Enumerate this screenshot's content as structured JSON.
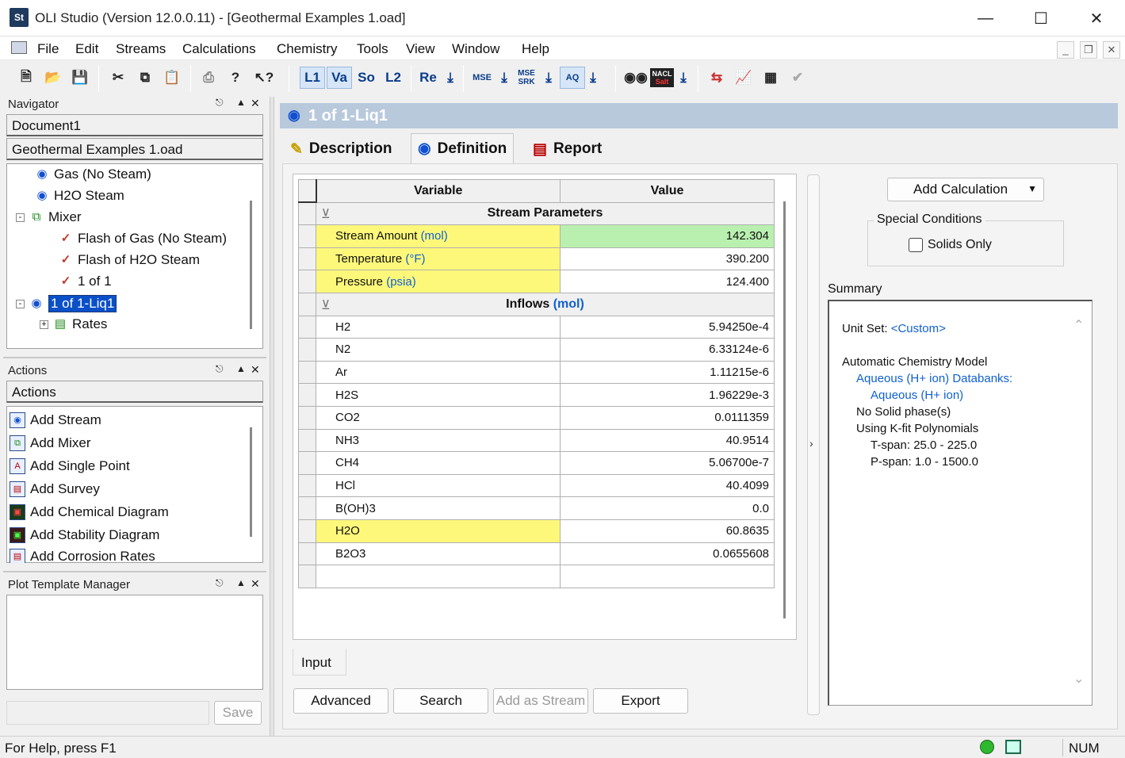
{
  "window": {
    "title": "OLI Studio (Version 12.0.0.11) - [Geothermal Examples 1.oad]",
    "app_icon": "St"
  },
  "menu": [
    "File",
    "Edit",
    "Streams",
    "Calculations",
    "Chemistry",
    "Tools",
    "View",
    "Window",
    "Help"
  ],
  "toolbar": {
    "l1": "L1",
    "va": "Va",
    "so": "So",
    "l2": "L2",
    "re": "Re",
    "mse": "MSE",
    "mse_srk": "MSE SRK",
    "aq": "AQ",
    "nacl": "NACL",
    "salt": "Salt"
  },
  "navigator": {
    "title": "Navigator",
    "document": "Document1",
    "file": "Geothermal Examples 1.oad",
    "tree": [
      "Gas (No Steam)",
      "H2O Steam",
      "Mixer",
      "Flash of Gas (No Steam)",
      "Flash of H2O Steam",
      "1 of 1",
      "1 of 1-Liq1",
      "Rates"
    ]
  },
  "actions": {
    "title": "Actions",
    "header": "Actions",
    "items": [
      "Add Stream",
      "Add Mixer",
      "Add Single Point",
      "Add Survey",
      "Add Chemical Diagram",
      "Add Stability Diagram",
      "Add Corrosion Rates"
    ]
  },
  "plot_template": {
    "title": "Plot Template Manager",
    "save": "Save"
  },
  "document": {
    "header": "1 of 1-Liq1",
    "tabs": [
      "Description",
      "Definition",
      "Report"
    ]
  },
  "grid": {
    "col_variable": "Variable",
    "col_value": "Value",
    "section_stream": "Stream Parameters",
    "params": [
      {
        "name": "Stream Amount",
        "unit": "(mol)",
        "value": "142.304"
      },
      {
        "name": "Temperature",
        "unit": "(°F)",
        "value": "390.200"
      },
      {
        "name": "Pressure",
        "unit": "(psia)",
        "value": "124.400"
      }
    ],
    "section_inflows": "Inflows",
    "inflows_unit": "(mol)",
    "inflows": [
      {
        "name": "H2",
        "value": "5.94250e-4"
      },
      {
        "name": "N2",
        "value": "6.33124e-6"
      },
      {
        "name": "Ar",
        "value": "1.11215e-6"
      },
      {
        "name": "H2S",
        "value": "1.96229e-3"
      },
      {
        "name": "CO2",
        "value": "0.0111359"
      },
      {
        "name": "NH3",
        "value": "40.9514"
      },
      {
        "name": "CH4",
        "value": "5.06700e-7"
      },
      {
        "name": "HCl",
        "value": "40.4099"
      },
      {
        "name": "B(OH)3",
        "value": "0.0"
      },
      {
        "name": "H2O",
        "value": "60.8635"
      },
      {
        "name": "B2O3",
        "value": "0.0655608"
      }
    ]
  },
  "input_tab": "Input",
  "buttons": {
    "advanced": "Advanced",
    "search": "Search",
    "add_as_stream": "Add as Stream",
    "export": "Export"
  },
  "right_panel": {
    "add_calculation": "Add Calculation",
    "special_conditions": "Special Conditions",
    "solids_only": "Solids Only",
    "summary_label": "Summary",
    "unit_set_label": "Unit Set:",
    "unit_set_value": "<Custom>",
    "model": "Automatic Chemistry Model",
    "databanks": "Aqueous (H+ ion) Databanks:",
    "databank": "Aqueous (H+ ion)",
    "solid": "No Solid phase(s)",
    "kfit": "Using K-fit Polynomials",
    "tspan": "T-span: 25.0 - 225.0",
    "pspan": "P-span: 1.0 - 1500.0"
  },
  "status": {
    "help": "For Help, press F1",
    "num": "NUM"
  },
  "colors": {
    "yellow": "#fdf87a",
    "green": "#b9f0b0",
    "link": "#1060d0",
    "header": "#b8c9dc"
  }
}
